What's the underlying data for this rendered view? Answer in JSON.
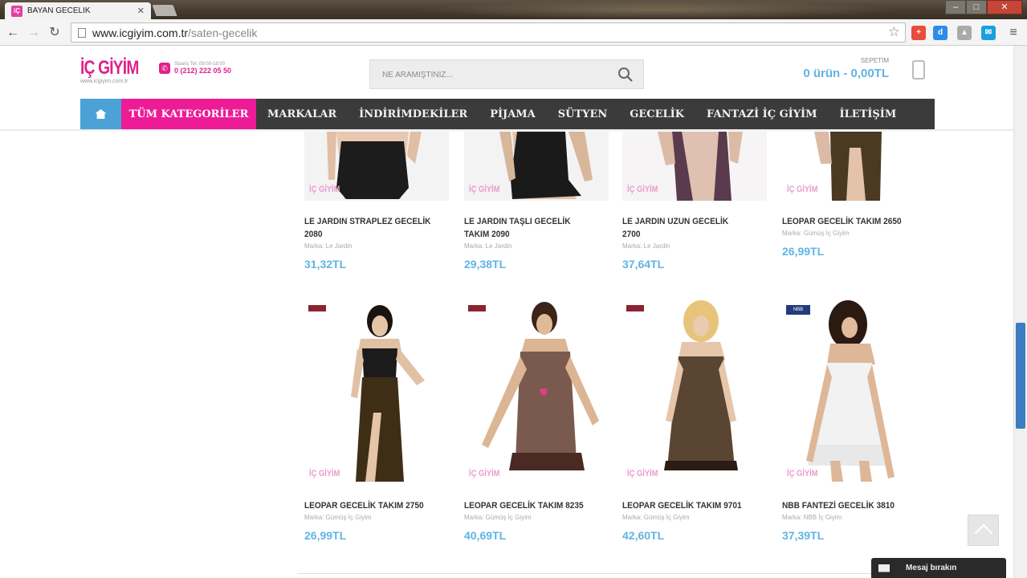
{
  "browser": {
    "tab_title": "BAYAN GECELİK",
    "tab_close": "✕",
    "url_domain": "www.icgiyim.com.tr",
    "url_path": "/saten-gecelik",
    "window_min": "–",
    "window_max": "□",
    "window_close": "✕"
  },
  "site": {
    "logo_text": "İÇ GİYİM",
    "logo_sub": "www.icgiyim.com.tr",
    "phone_hours": "Sipariş Tel: 09:00-18:00",
    "phone_number": "0 (212) 222 05 50",
    "search_placeholder": "NE ARAMIŞTINIZ...",
    "cart_label": "SEPETİM",
    "cart_value": "0 ürün - 0,00TL"
  },
  "menu": {
    "all_categories": "TÜM KATEGORİLER",
    "items": [
      "MARKALAR",
      "İNDİRİMDEKİLER",
      "PİJAMA",
      "SÜTYEN",
      "GECELİK",
      "FANTAZİ İÇ GİYİM",
      "İLETİŞİM"
    ]
  },
  "products_top": [
    {
      "name1": "LE JARDIN STRAPLEZ GECELİK",
      "name2": "2080",
      "brand": "Marka: Le Jardin",
      "price": "31,32TL"
    },
    {
      "name1": "LE JARDIN TAŞLI GECELİK",
      "name2": "TAKIM 2090",
      "brand": "Marka: Le Jardin",
      "price": "29,38TL"
    },
    {
      "name1": "LE JARDIN UZUN GECELİK",
      "name2": "2700",
      "brand": "Marka: Le Jardin",
      "price": "37,64TL"
    },
    {
      "name1": "LEOPAR GECELİK TAKIM 2650",
      "name2": "",
      "brand": "Marka: Gümüş İç Giyim",
      "price": "26,99TL"
    }
  ],
  "products_bottom": [
    {
      "name1": "LEOPAR GECELİK TAKIM 2750",
      "brand": "Marka: Gümüş İç Giyim",
      "price": "26,99TL",
      "badge": ""
    },
    {
      "name1": "LEOPAR GECELİK TAKIM 8235",
      "brand": "Marka: Gümüş İç Giyim",
      "price": "40,69TL",
      "badge": ""
    },
    {
      "name1": "LEOPAR GECELİK TAKIM 9701",
      "brand": "Marka: Gümüş İç Giyim",
      "price": "42,60TL",
      "badge": ""
    },
    {
      "name1": "NBB FANTEZİ GECELİK 3810",
      "brand": "Marka: NBB İç Giyim",
      "price": "37,39TL",
      "badge": "NBB"
    }
  ],
  "watermark": "İÇ GİYİM",
  "message_button": "Mesaj bırakın",
  "colors": {
    "brand_pink": "#ee1b97",
    "accent_blue": "#5fb4e4",
    "menu_dark": "#3b3b3b",
    "home_blue": "#4aa2d6"
  },
  "icons": [
    "back-arrow-icon",
    "forward-arrow-icon",
    "reload-icon",
    "star-icon",
    "search-icon",
    "phone-icon",
    "shopping-bag-icon",
    "home-icon",
    "envelope-icon",
    "chevron-up-icon"
  ]
}
